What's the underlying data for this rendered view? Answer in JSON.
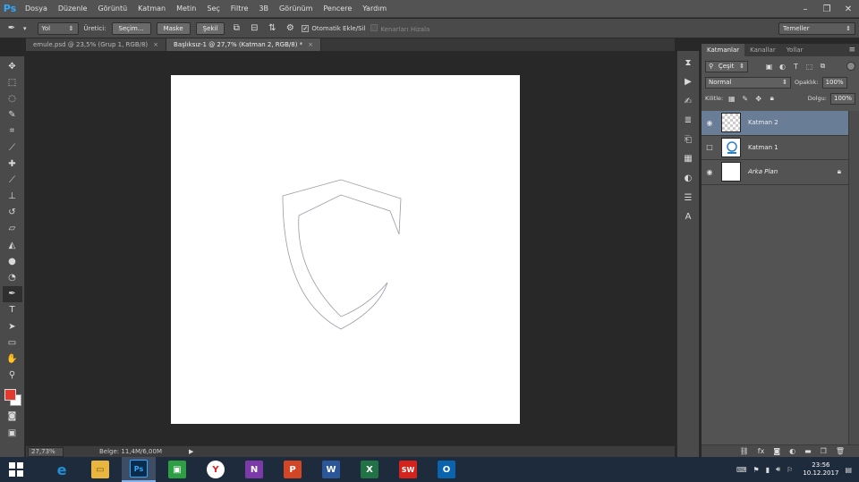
{
  "app": {
    "logo": "Ps"
  },
  "menu": [
    "Dosya",
    "Düzenle",
    "Görüntü",
    "Katman",
    "Metin",
    "Seç",
    "Filtre",
    "3B",
    "Görünüm",
    "Pencere",
    "Yardım"
  ],
  "window_controls": {
    "minimize": "–",
    "maximize": "❐",
    "close": "✕"
  },
  "options": {
    "mode_select": "Yol",
    "make_label": "Üretici:",
    "selection_btn": "Seçim...",
    "mask_btn": "Maske",
    "shape_btn": "Şekil",
    "auto_add_delete": "Otomatik Ekle/Sil",
    "align_edges": "Kenarları Hizala",
    "workspace": "Temeller"
  },
  "tabs": [
    {
      "label": "emule.psd @ 23,5% (Grup 1, RGB/8)",
      "close": "×"
    },
    {
      "label": "Başlıksız-1 @ 27,7% (Katman 2, RGB/8) *",
      "close": "×"
    }
  ],
  "status": {
    "zoom": "27,73%",
    "doc": "Belge: 11,4M/6,00M",
    "arrow": "▶"
  },
  "colors": {
    "foreground": "#e23a2f",
    "background": "#ffffff",
    "accent": "#31a8ff",
    "layer_selected": "#6a7d97"
  },
  "layers_panel": {
    "tabs": [
      "Katmanlar",
      "Kanallar",
      "Yollar"
    ],
    "menu_icon": "≡",
    "filter_kind": "Çeşit",
    "blend_mode": "Normal",
    "opacity_label": "Opaklık:",
    "opacity_value": "100%",
    "lock_label": "Kilitle:",
    "fill_label": "Dolgu:",
    "fill_value": "100%",
    "layers": [
      {
        "name": "Katman 2",
        "visible": true,
        "selected": true,
        "thumb": "transparent"
      },
      {
        "name": "Katman 1",
        "visible": false,
        "selected": false,
        "thumb": "logo"
      },
      {
        "name": "Arka Plan",
        "visible": true,
        "selected": false,
        "thumb": "white",
        "locked": true
      }
    ],
    "footer_icons": [
      "link-icon",
      "fx-icon",
      "mask-icon",
      "adjustment-icon",
      "group-icon",
      "new-layer-icon",
      "trash-icon"
    ]
  },
  "taskbar": {
    "apps": [
      {
        "name": "internet-explorer",
        "glyph": "e",
        "color": "#1e90d6"
      },
      {
        "name": "file-explorer",
        "glyph": "▭",
        "color": "#e8b640"
      },
      {
        "name": "photoshop",
        "glyph": "Ps",
        "color": "#0b2b4a"
      },
      {
        "name": "store",
        "glyph": "▣",
        "color": "#2e9e44"
      },
      {
        "name": "yandex-browser",
        "glyph": "Y",
        "color": "#ffffff"
      },
      {
        "name": "onenote",
        "glyph": "N",
        "color": "#7b3aa8"
      },
      {
        "name": "powerpoint",
        "glyph": "P",
        "color": "#d24625"
      },
      {
        "name": "word",
        "glyph": "W",
        "color": "#2b579a"
      },
      {
        "name": "excel",
        "glyph": "X",
        "color": "#217346"
      },
      {
        "name": "solidworks",
        "glyph": "SW",
        "color": "#d4221c"
      },
      {
        "name": "outlook",
        "glyph": "O",
        "color": "#0a64ad"
      }
    ],
    "time": "23:56",
    "date": "10.12.2017"
  }
}
